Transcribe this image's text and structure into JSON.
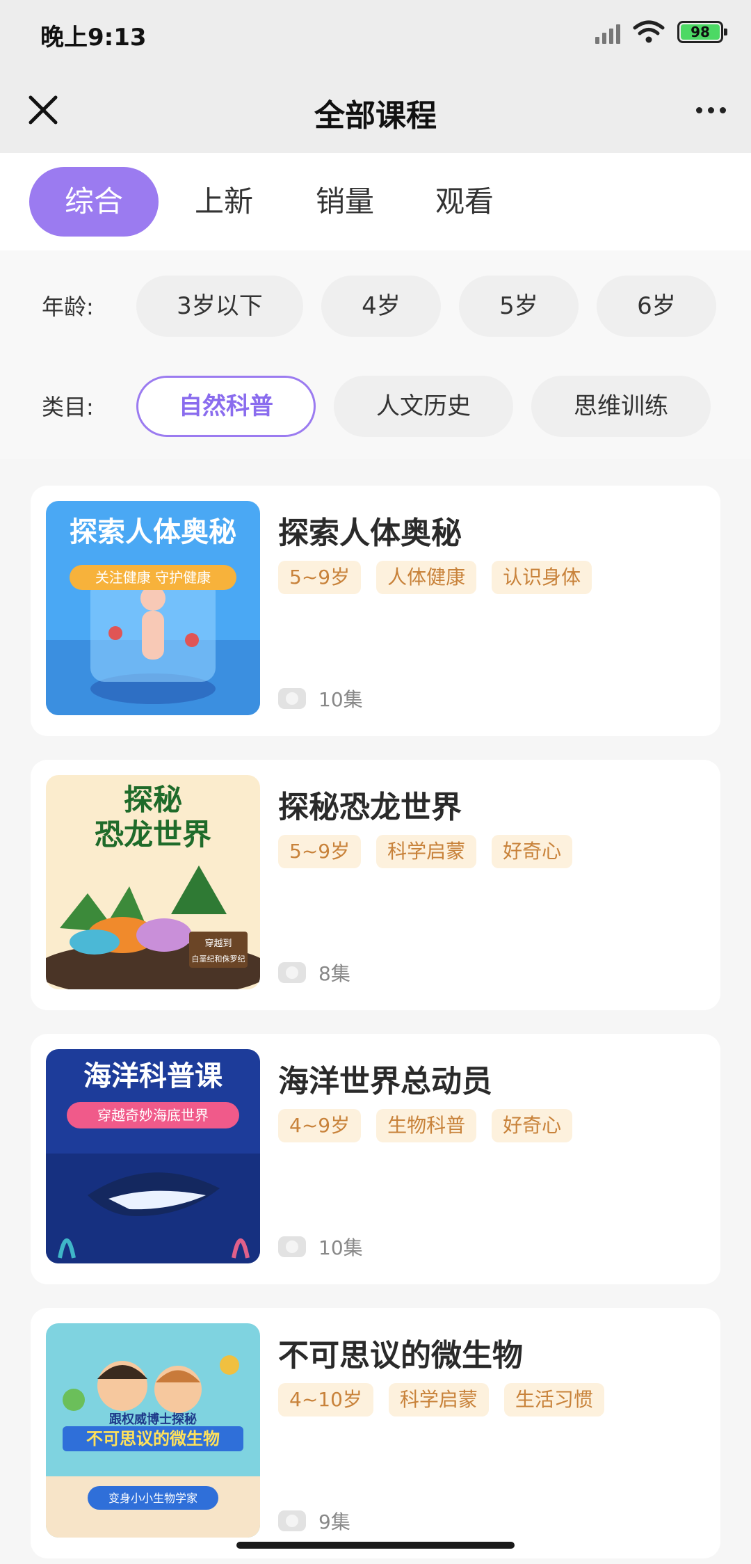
{
  "status": {
    "time": "晚上9:13",
    "battery": "98"
  },
  "nav": {
    "title": "全部课程"
  },
  "sort_tabs": [
    {
      "label": "综合",
      "active": true
    },
    {
      "label": "上新",
      "active": false
    },
    {
      "label": "销量",
      "active": false
    },
    {
      "label": "观看",
      "active": false
    }
  ],
  "filters": {
    "age": {
      "label": "年龄:",
      "options": [
        "3岁以下",
        "4岁",
        "5岁",
        "6岁"
      ]
    },
    "category": {
      "label": "类目:",
      "options": [
        "自然科普",
        "人文历史",
        "思维训练"
      ],
      "selected": "自然科普"
    }
  },
  "courses": [
    {
      "title": "探索人体奥秘",
      "tags": [
        "5~9岁",
        "人体健康",
        "认识身体"
      ],
      "episodes": "10集",
      "thumb": {
        "heading": "探索人体奥秘",
        "sub": "关注健康 守护健康"
      }
    },
    {
      "title": "探秘恐龙世界",
      "tags": [
        "5~9岁",
        "科学启蒙",
        "好奇心"
      ],
      "episodes": "8集",
      "thumb": {
        "heading_line1": "探秘",
        "heading_line2": "恐龙世界",
        "sign1": "穿越到",
        "sign2": "白垩纪和侏罗纪"
      }
    },
    {
      "title": "海洋世界总动员",
      "tags": [
        "4~9岁",
        "生物科普",
        "好奇心"
      ],
      "episodes": "10集",
      "thumb": {
        "heading": "海洋科普课",
        "sub": "穿越奇妙海底世界"
      }
    },
    {
      "title": "不可思议的微生物",
      "tags": [
        "4~10岁",
        "科学启蒙",
        "生活习惯"
      ],
      "episodes": "9集",
      "thumb": {
        "line1": "跟权威博士探秘",
        "line2": "不可思议的微生物",
        "line3": "变身小小生物学家"
      }
    }
  ],
  "colors": {
    "accent": "#9b7bf0",
    "tag_bg": "#fdf1dd",
    "tag_text": "#c8823a"
  }
}
